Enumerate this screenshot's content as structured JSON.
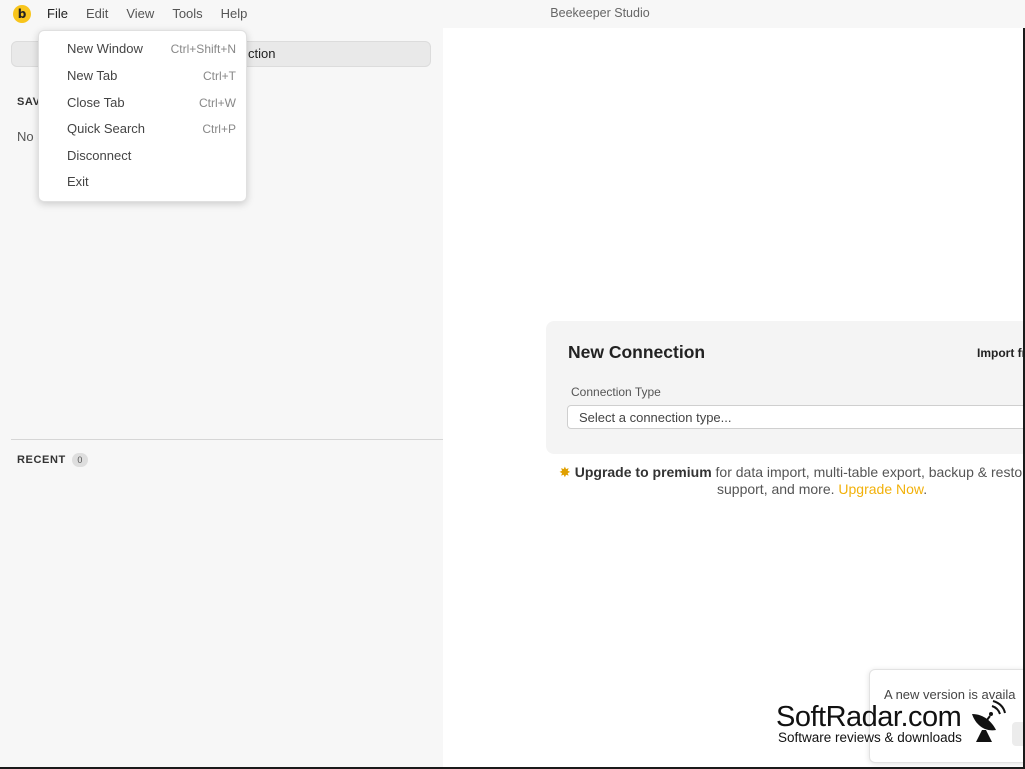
{
  "app": {
    "title": "Beekeeper Studio",
    "logo_letter": "b"
  },
  "menubar": {
    "items": [
      {
        "label": "File"
      },
      {
        "label": "Edit"
      },
      {
        "label": "View"
      },
      {
        "label": "Tools"
      },
      {
        "label": "Help"
      }
    ]
  },
  "file_menu": {
    "items": [
      {
        "label": "New Window",
        "shortcut": "Ctrl+Shift+N"
      },
      {
        "label": "New Tab",
        "shortcut": "Ctrl+T"
      },
      {
        "label": "Close Tab",
        "shortcut": "Ctrl+W"
      },
      {
        "label": "Quick Search",
        "shortcut": "Ctrl+P"
      },
      {
        "label": "Disconnect",
        "shortcut": ""
      },
      {
        "label": "Exit",
        "shortcut": ""
      }
    ]
  },
  "sidebar": {
    "new_connection_button_visible": "ction",
    "saved_heading_visible": "SAV",
    "no_saved_visible": "No S",
    "recent_heading": "RECENT",
    "recent_count": "0"
  },
  "main": {
    "new_connection": {
      "title": "New Connection",
      "import_link": "Import fr",
      "connection_type_label": "Connection Type",
      "connection_type_placeholder": "Select a connection type..."
    },
    "upsell": {
      "bold": "Upgrade to premium",
      "line1_rest": "for data import, multi-table export, backup & resto",
      "line2": "support, and more.",
      "link": "Upgrade Now",
      "tail": "."
    },
    "update_toast": {
      "text": "A new version is availa"
    }
  },
  "watermark": {
    "name": "SoftRadar.com",
    "tagline": "Software reviews & downloads"
  },
  "colors": {
    "accent": "#f8c51c",
    "link": "#f2b10a"
  }
}
